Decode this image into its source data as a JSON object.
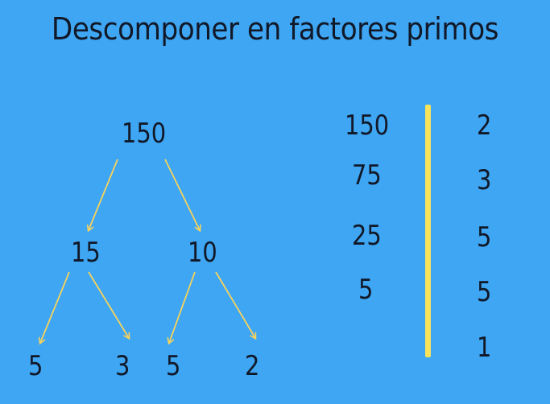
{
  "title": "Descomponer en factores primos",
  "tree": {
    "root": "150",
    "left": "15",
    "right": "10",
    "left_leaves": [
      "5",
      "3"
    ],
    "right_leaves": [
      "5",
      "2"
    ]
  },
  "table": {
    "dividends": [
      "150",
      "75",
      "25",
      "5"
    ],
    "divisors": [
      "2",
      "3",
      "5",
      "5",
      "1"
    ]
  },
  "colors": {
    "background": "#3fa6f3",
    "arrow": "#f7d35c",
    "divider": "#f7e35c",
    "text": "#111827"
  }
}
